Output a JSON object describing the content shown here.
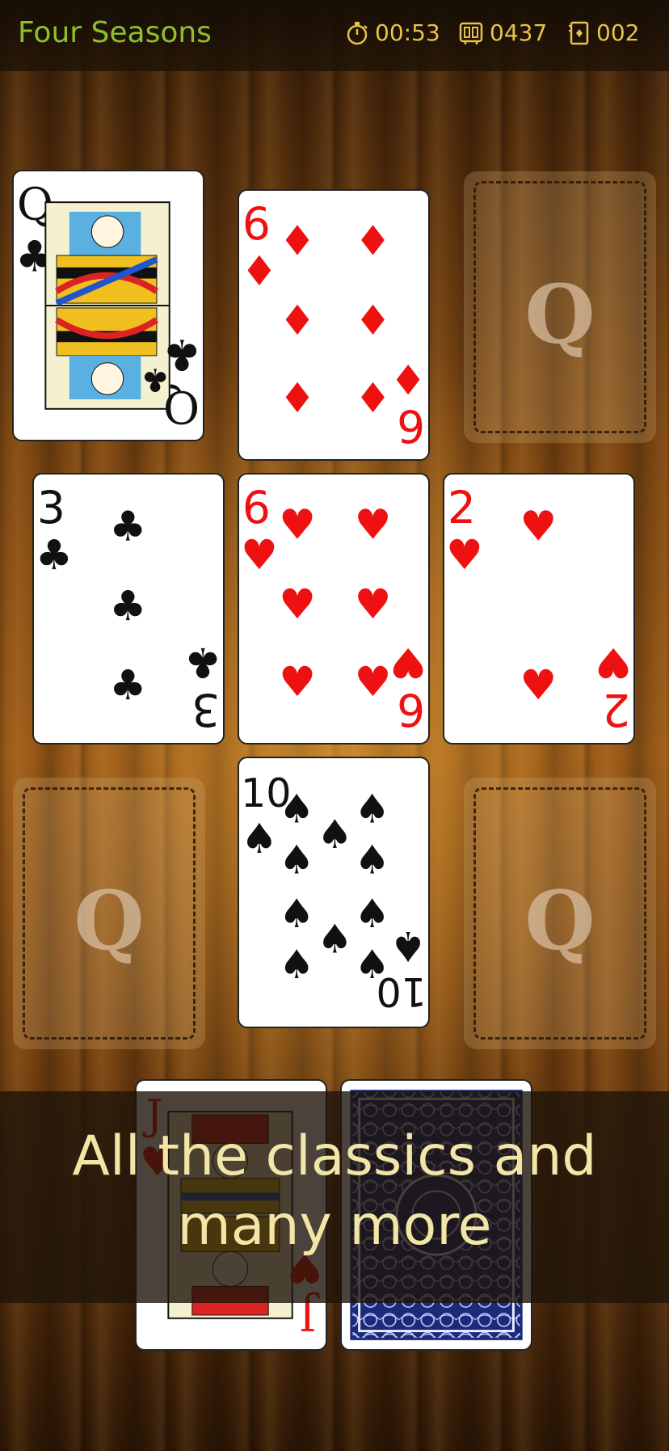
{
  "app": {
    "title": "Four Seasons"
  },
  "stats": {
    "time": {
      "icon": "stopwatch-icon",
      "value": "00:53"
    },
    "moves": {
      "icon": "scoreboard-icon",
      "value": "0437"
    },
    "stock": {
      "icon": "card-deck-icon",
      "value": "002"
    }
  },
  "colors": {
    "title": "#8dc12a",
    "stats": "#e7c34a",
    "banner_text": "#f2e6a6",
    "red_suit": "#ee1111",
    "black_suit": "#111111"
  },
  "tableau": {
    "foundation_top_left": {
      "rank": "Q",
      "suit": "clubs",
      "face": "queen"
    },
    "top_center": {
      "rank": "6",
      "suit": "diamonds"
    },
    "foundation_top_right": {
      "empty_label": "Q"
    },
    "middle_left": {
      "rank": "3",
      "suit": "clubs"
    },
    "middle_center": {
      "rank": "6",
      "suit": "hearts"
    },
    "middle_right": {
      "rank": "2",
      "suit": "hearts"
    },
    "foundation_bottom_left": {
      "empty_label": "Q"
    },
    "bottom_center": {
      "rank": "10",
      "suit": "spades"
    },
    "foundation_bottom_right": {
      "empty_label": "Q"
    },
    "waste": {
      "rank": "J",
      "suit": "hearts",
      "face": "jack"
    },
    "stock": {
      "face_down": true
    }
  },
  "banner": {
    "line1": "All the classics and",
    "line2": "many more"
  }
}
